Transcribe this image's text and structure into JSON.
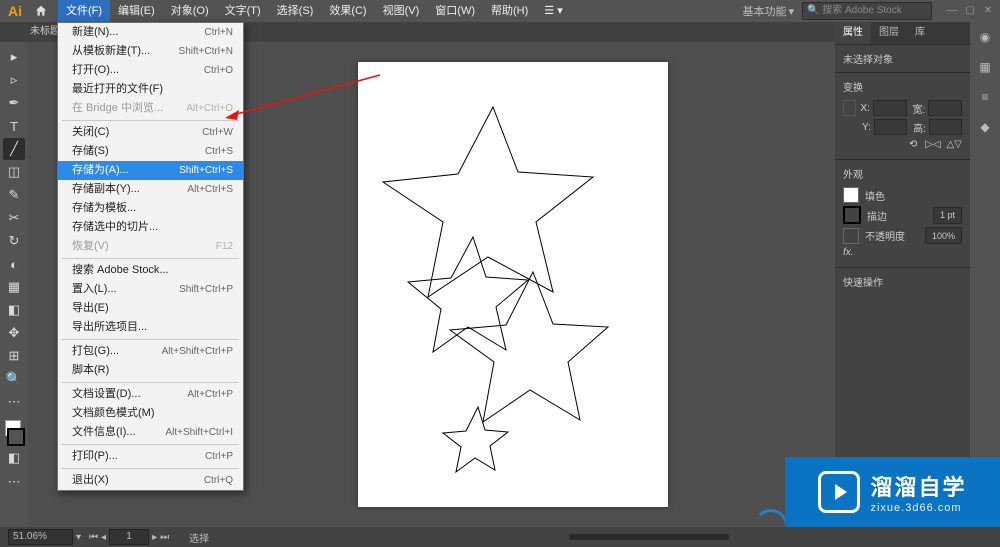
{
  "menubar": {
    "items": [
      "文件(F)",
      "编辑(E)",
      "对象(O)",
      "文字(T)",
      "选择(S)",
      "效果(C)",
      "视图(V)",
      "窗口(W)",
      "帮助(H)"
    ],
    "workspace": "基本功能",
    "search_placeholder": "搜索 Adobe Stock"
  },
  "doc_tab": "未标题",
  "file_menu": [
    {
      "label": "新建(N)...",
      "sc": "Ctrl+N"
    },
    {
      "label": "从模板新建(T)...",
      "sc": "Shift+Ctrl+N"
    },
    {
      "label": "打开(O)...",
      "sc": "Ctrl+O"
    },
    {
      "label": "最近打开的文件(F)",
      "sc": ""
    },
    {
      "label": "在 Bridge 中浏览...",
      "sc": "Alt+Ctrl+O",
      "disabled": true
    },
    {
      "sep": true
    },
    {
      "label": "关闭(C)",
      "sc": "Ctrl+W"
    },
    {
      "label": "存储(S)",
      "sc": "Ctrl+S"
    },
    {
      "label": "存储为(A)...",
      "sc": "Shift+Ctrl+S",
      "hl": true
    },
    {
      "label": "存储副本(Y)...",
      "sc": "Alt+Ctrl+S"
    },
    {
      "label": "存储为模板...",
      "sc": ""
    },
    {
      "label": "存储选中的切片...",
      "sc": ""
    },
    {
      "label": "恢复(V)",
      "sc": "F12",
      "disabled": true
    },
    {
      "sep": true
    },
    {
      "label": "搜索 Adobe Stock...",
      "sc": ""
    },
    {
      "label": "置入(L)...",
      "sc": "Shift+Ctrl+P"
    },
    {
      "label": "导出(E)",
      "sc": ""
    },
    {
      "label": "导出所选项目...",
      "sc": ""
    },
    {
      "sep": true
    },
    {
      "label": "打包(G)...",
      "sc": "Alt+Shift+Ctrl+P"
    },
    {
      "label": "脚本(R)",
      "sc": ""
    },
    {
      "sep": true
    },
    {
      "label": "文档设置(D)...",
      "sc": "Alt+Ctrl+P"
    },
    {
      "label": "文档颜色模式(M)",
      "sc": ""
    },
    {
      "label": "文件信息(I)...",
      "sc": "Alt+Shift+Ctrl+I"
    },
    {
      "sep": true
    },
    {
      "label": "打印(P)...",
      "sc": "Ctrl+P"
    },
    {
      "sep": true
    },
    {
      "label": "退出(X)",
      "sc": "Ctrl+Q"
    }
  ],
  "tools": [
    "▸",
    "▹",
    "✒",
    "T",
    "╱",
    "◫",
    "✎",
    "✂",
    "↻",
    "◐",
    "▦",
    "◧",
    "✥",
    "⊞",
    "🔍",
    "⋯"
  ],
  "right": {
    "tabs": [
      "属性",
      "图层",
      "库"
    ],
    "no_sel": "未选择对象",
    "transform": "变换",
    "x": "X:",
    "y": "Y:",
    "w": "宽:",
    "h": "高:",
    "appearance": "外观",
    "fill": "填色",
    "stroke": "描边",
    "stroke_val": "1 pt",
    "opacity": "不透明度",
    "opacity_val": "100%",
    "fx": "fx.",
    "quick": "快速操作"
  },
  "status": {
    "zoom": "51.06%",
    "page": "1",
    "sel": "选择"
  },
  "watermark": {
    "big": "溜溜自学",
    "small": "zixue.3d66.com"
  }
}
